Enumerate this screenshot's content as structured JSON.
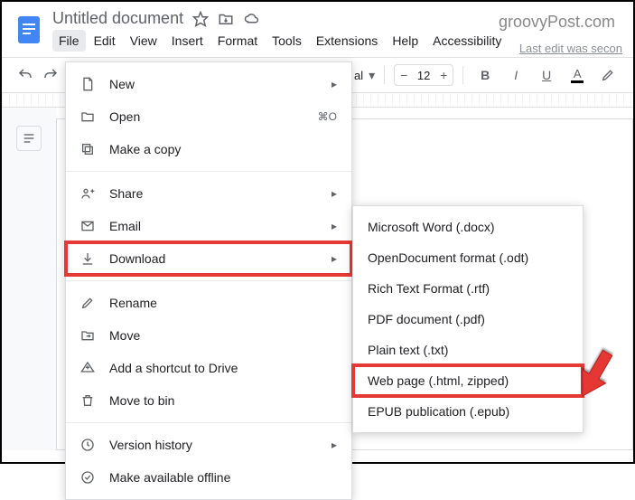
{
  "title": "Untitled document",
  "brand": "groovyPost.com",
  "lastedit": "Last edit was secon",
  "menubar": [
    "File",
    "Edit",
    "View",
    "Insert",
    "Format",
    "Tools",
    "Extensions",
    "Help",
    "Accessibility"
  ],
  "toolbar": {
    "fontStyleHint": "al",
    "fontSize": "12"
  },
  "fileMenu": {
    "new": "New",
    "open": "Open",
    "openShortcut": "⌘O",
    "copy": "Make a copy",
    "share": "Share",
    "email": "Email",
    "download": "Download",
    "rename": "Rename",
    "move": "Move",
    "shortcut": "Add a shortcut to Drive",
    "bin": "Move to bin",
    "version": "Version history",
    "offline": "Make available offline"
  },
  "downloadSub": [
    "Microsoft Word (.docx)",
    "OpenDocument format (.odt)",
    "Rich Text Format (.rtf)",
    "PDF document (.pdf)",
    "Plain text (.txt)",
    "Web page (.html, zipped)",
    "EPUB publication (.epub)"
  ]
}
